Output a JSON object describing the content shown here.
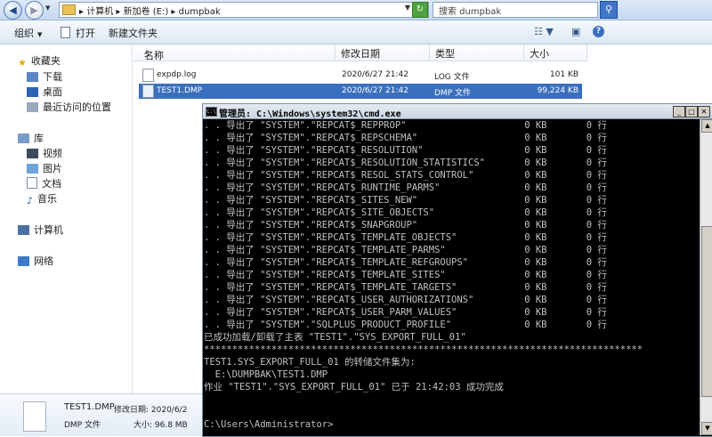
{
  "address": {
    "path": "▸ 计算机 ▸ 新加卷 (E:) ▸ dumpbak",
    "search_placeholder": "搜索 dumpbak"
  },
  "toolbar": {
    "organize": "组织",
    "open": "打开",
    "new_folder": "新建文件夹"
  },
  "nav": {
    "favorites": "收藏夹",
    "downloads": "下载",
    "desktop": "桌面",
    "recent": "最近访问的位置",
    "libraries": "库",
    "videos": "视频",
    "pictures": "图片",
    "documents": "文档",
    "music": "音乐",
    "computer": "计算机",
    "network": "网络"
  },
  "columns": {
    "name": "名称",
    "modified": "修改日期",
    "type": "类型",
    "size": "大小"
  },
  "files": [
    {
      "name": "expdp.log",
      "modified": "2020/6/27 21:42",
      "type": "LOG 文件",
      "size": "101 KB"
    },
    {
      "name": "TEST1.DMP",
      "modified": "2020/6/27 21:42",
      "type": "DMP 文件",
      "size": "99,224 KB"
    }
  ],
  "details": {
    "name": "TEST1.DMP",
    "modified_label": "修改日期: 2020/6/2",
    "type": "DMP 文件",
    "size_label": "大小: 96.8 MB"
  },
  "cmd": {
    "title": "管理员: C:\\Windows\\system32\\cmd.exe",
    "lines": [
      ". . 导出了 \"SYSTEM\".\"REPCAT$_REPPROP\"                     0 KB       0 行",
      ". . 导出了 \"SYSTEM\".\"REPCAT$_REPSCHEMA\"                   0 KB       0 行",
      ". . 导出了 \"SYSTEM\".\"REPCAT$_RESOLUTION\"                  0 KB       0 行",
      ". . 导出了 \"SYSTEM\".\"REPCAT$_RESOLUTION_STATISTICS\"       0 KB       0 行",
      ". . 导出了 \"SYSTEM\".\"REPCAT$_RESOL_STATS_CONTROL\"         0 KB       0 行",
      ". . 导出了 \"SYSTEM\".\"REPCAT$_RUNTIME_PARMS\"               0 KB       0 行",
      ". . 导出了 \"SYSTEM\".\"REPCAT$_SITES_NEW\"                   0 KB       0 行",
      ". . 导出了 \"SYSTEM\".\"REPCAT$_SITE_OBJECTS\"                0 KB       0 行",
      ". . 导出了 \"SYSTEM\".\"REPCAT$_SNAPGROUP\"                   0 KB       0 行",
      ". . 导出了 \"SYSTEM\".\"REPCAT$_TEMPLATE_OBJECTS\"            0 KB       0 行",
      ". . 导出了 \"SYSTEM\".\"REPCAT$_TEMPLATE_PARMS\"              0 KB       0 行",
      ". . 导出了 \"SYSTEM\".\"REPCAT$_TEMPLATE_REFGROUPS\"          0 KB       0 行",
      ". . 导出了 \"SYSTEM\".\"REPCAT$_TEMPLATE_SITES\"              0 KB       0 行",
      ". . 导出了 \"SYSTEM\".\"REPCAT$_TEMPLATE_TARGETS\"            0 KB       0 行",
      ". . 导出了 \"SYSTEM\".\"REPCAT$_USER_AUTHORIZATIONS\"         0 KB       0 行",
      ". . 导出了 \"SYSTEM\".\"REPCAT$_USER_PARM_VALUES\"            0 KB       0 行",
      ". . 导出了 \"SYSTEM\".\"SQLPLUS_PRODUCT_PROFILE\"             0 KB       0 行",
      "已成功加载/卸载了主表 \"TEST1\".\"SYS_EXPORT_FULL_01\"",
      "******************************************************************************",
      "TEST1.SYS_EXPORT_FULL_01 的转储文件集为:",
      "  E:\\DUMPBAK\\TEST1.DMP",
      "作业 \"TEST1\".\"SYS_EXPORT_FULL_01\" 已于 21:42:03 成功完成",
      "",
      "",
      "C:\\Users\\Administrator>"
    ]
  }
}
